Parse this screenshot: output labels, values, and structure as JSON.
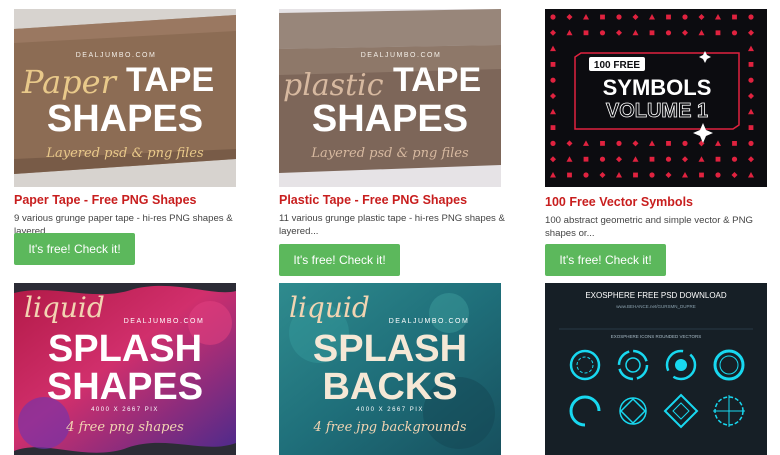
{
  "cards": [
    {
      "title": "Paper Tape - Free PNG Shapes",
      "description": "9 various grunge paper tape - hi-res PNG shapes & layered...",
      "button_label": "It's free! Check it!",
      "thumb": {
        "script": "Paper",
        "line1": "TAPE",
        "line2": "SHAPES",
        "sub": "Layered psd & png files",
        "brand": "DEALJUMBO.COM"
      }
    },
    {
      "title": "Plastic Tape - Free PNG Shapes",
      "description": "11 various grunge plastic tape - hi-res PNG shapes & layered...",
      "button_label": "It's free! Check it!",
      "thumb": {
        "script": "plastic",
        "line1": "TAPE",
        "line2": "SHAPES",
        "sub": "Layered psd & png files",
        "brand": "DEALJUMBO.COM"
      }
    },
    {
      "title": "100 Free Vector Symbols",
      "description": "100 abstract geometric and simple vector & PNG shapes or...",
      "button_label": "It's free! Check it!",
      "thumb": {
        "badge": "100 FREE",
        "line1": "SYMBOLS",
        "line2": "VOLUME 1"
      }
    },
    {
      "thumb": {
        "script": "liquid",
        "line1": "SPLASH",
        "line2": "SHAPES",
        "res": "4000 X 2667 PIX",
        "sub": "4 free png shapes",
        "brand": "DEALJUMBO.COM"
      }
    },
    {
      "thumb": {
        "script": "liquid",
        "line1": "SPLASH",
        "line2": "BACKS",
        "res": "4000 X 2667 PIX",
        "sub": "4 free jpg backgrounds",
        "brand": "DEALJUMBO.COM"
      }
    },
    {
      "thumb": {
        "heading": "EXOSPHERE FREE PSD DOWNLOAD",
        "subheading": "www.BEHANCE.net/GURSMN_DUPRE",
        "label": "EXOSPHERE ICONS ROUNDED VECTORS"
      }
    }
  ],
  "colors": {
    "title_red": "#c81e1e",
    "button_green": "#5cb85c",
    "symbols_bg": "#0c0c10",
    "symbols_accent": "#e0223f",
    "exosphere_cyan": "#18d8f0"
  }
}
